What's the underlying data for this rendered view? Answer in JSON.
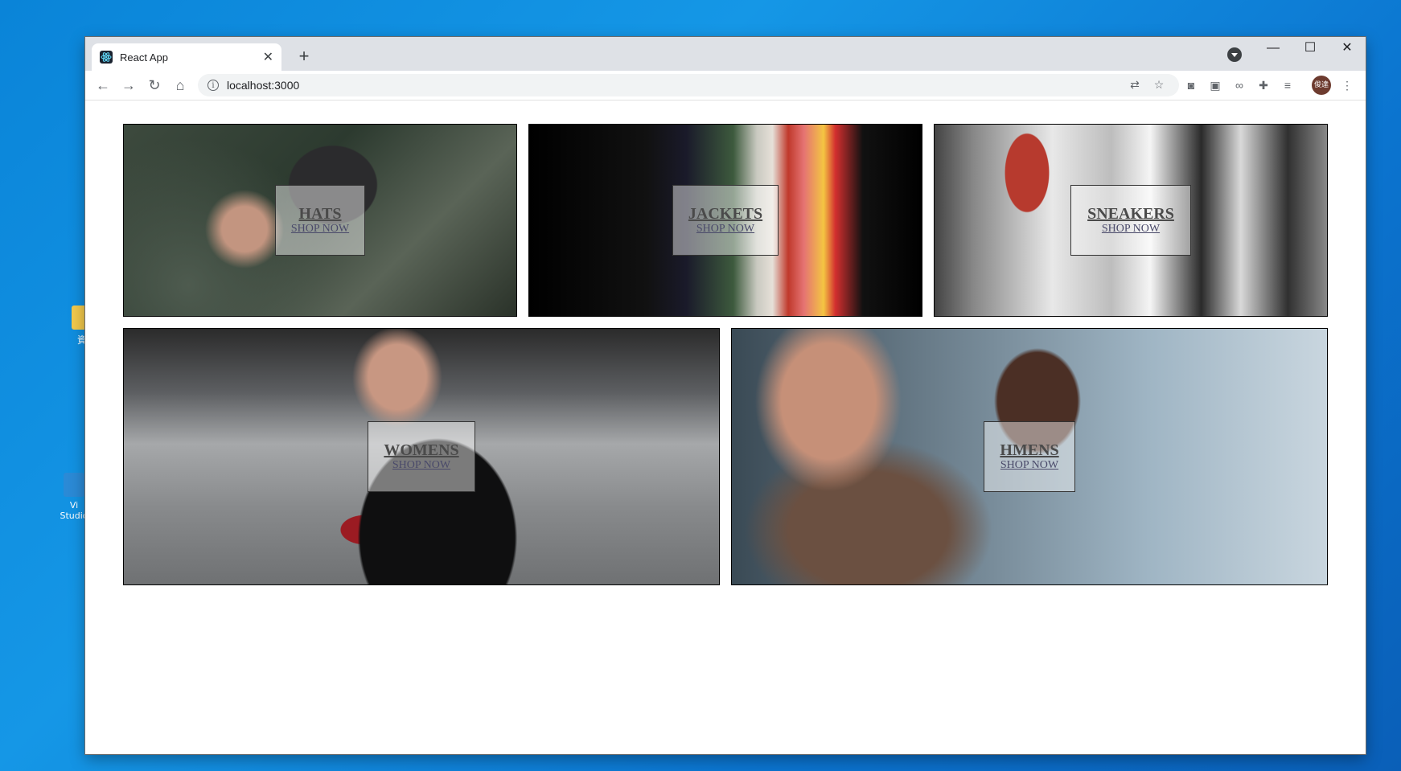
{
  "browser": {
    "tab_title": "React App",
    "new_tab_label": "+",
    "url": "localhost:3000",
    "window_controls": {
      "minimize": "—",
      "maximize": "☐",
      "close": "✕"
    },
    "avatar_text": "俊達"
  },
  "directory": {
    "items": [
      {
        "title": "HATS",
        "subtitle": "SHOP NOW"
      },
      {
        "title": "JACKETS",
        "subtitle": "SHOP NOW"
      },
      {
        "title": "SNEAKERS",
        "subtitle": "SHOP NOW"
      },
      {
        "title": "WOMENS",
        "subtitle": "SHOP NOW"
      },
      {
        "title": "HMENS",
        "subtitle": "SHOP NOW"
      }
    ]
  },
  "desktop": {
    "icons": [
      {
        "label": "資"
      },
      {
        "label": "Vi\nStudio"
      }
    ]
  }
}
